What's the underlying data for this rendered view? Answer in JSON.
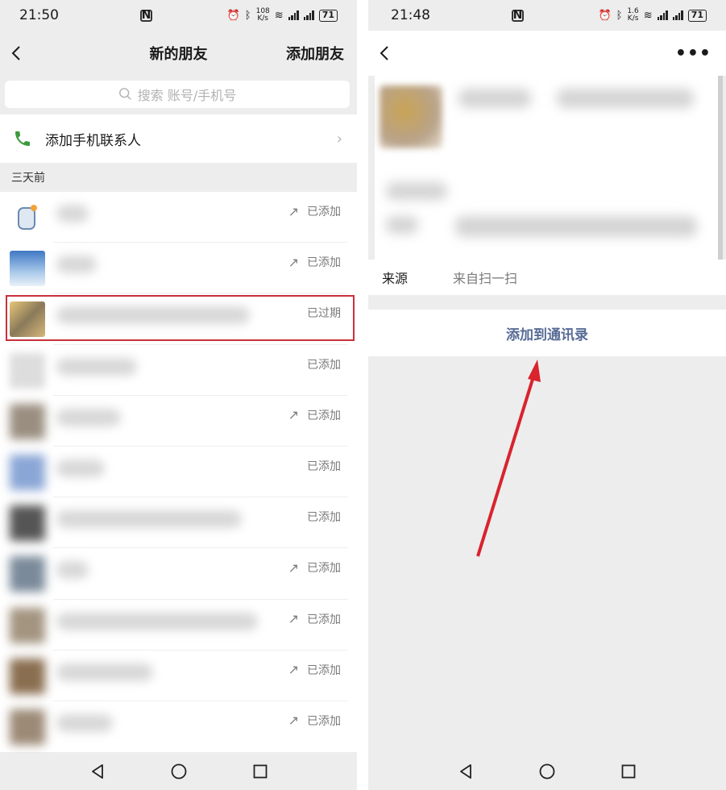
{
  "left": {
    "status": {
      "time": "21:50",
      "speed_top": "108",
      "speed_bottom": "K/s",
      "battery": "71"
    },
    "nav": {
      "title": "新的朋友",
      "action": "添加朋友"
    },
    "search": {
      "placeholder": "搜索 账号/手机号"
    },
    "phone_contacts": {
      "label": "添加手机联系人"
    },
    "section": "三天前",
    "rows": [
      {
        "status": "已添加",
        "arrow": true
      },
      {
        "status": "已添加",
        "arrow": true
      },
      {
        "status": "已过期",
        "arrow": false
      },
      {
        "status": "已添加",
        "arrow": false
      },
      {
        "status": "已添加",
        "arrow": true
      },
      {
        "status": "已添加",
        "arrow": false
      },
      {
        "status": "已添加",
        "arrow": false
      },
      {
        "status": "已添加",
        "arrow": true
      },
      {
        "status": "已添加",
        "arrow": true
      },
      {
        "status": "已添加",
        "arrow": true
      },
      {
        "status": "已添加",
        "arrow": true
      }
    ]
  },
  "right": {
    "status": {
      "time": "21:48",
      "speed_top": "1.6",
      "speed_bottom": "K/s",
      "battery": "71"
    },
    "source": {
      "label": "来源",
      "value": "来自扫一扫"
    },
    "add_button": "添加到通讯录"
  },
  "colors": {
    "link": "#576b95",
    "highlight_border": "#c9303c",
    "arrow": "#d9232d",
    "phone_icon": "#3c9a3c"
  }
}
